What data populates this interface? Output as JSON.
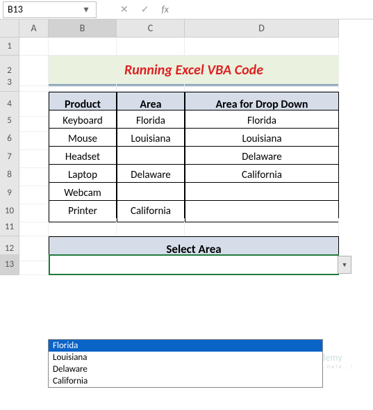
{
  "namebox": "B13",
  "fx_label": "fx",
  "cols": [
    "",
    "A",
    "B",
    "C",
    "D"
  ],
  "rows": [
    "1",
    "2",
    "3",
    "4",
    "5",
    "6",
    "7",
    "8",
    "9",
    "10",
    "11",
    "12",
    "13"
  ],
  "title": "Running Excel VBA Code",
  "table": {
    "headers": [
      "Product",
      "Area",
      "Area for Drop Down"
    ],
    "rows": [
      [
        "Keyboard",
        "Florida",
        "Florida"
      ],
      [
        "Mouse",
        "Louisiana",
        "Louisiana"
      ],
      [
        "Headset",
        "",
        "Delaware"
      ],
      [
        "Laptop",
        "Delaware",
        "California"
      ],
      [
        "Webcam",
        "",
        ""
      ],
      [
        "Printer",
        "California",
        ""
      ]
    ]
  },
  "select_label": "Select Area",
  "select_value": "",
  "dropdown": [
    "Florida",
    "Louisiana",
    "Delaware",
    "California"
  ],
  "watermark": {
    "brand": "exceldemy",
    "tag": "EXCEL...DATA...!"
  }
}
